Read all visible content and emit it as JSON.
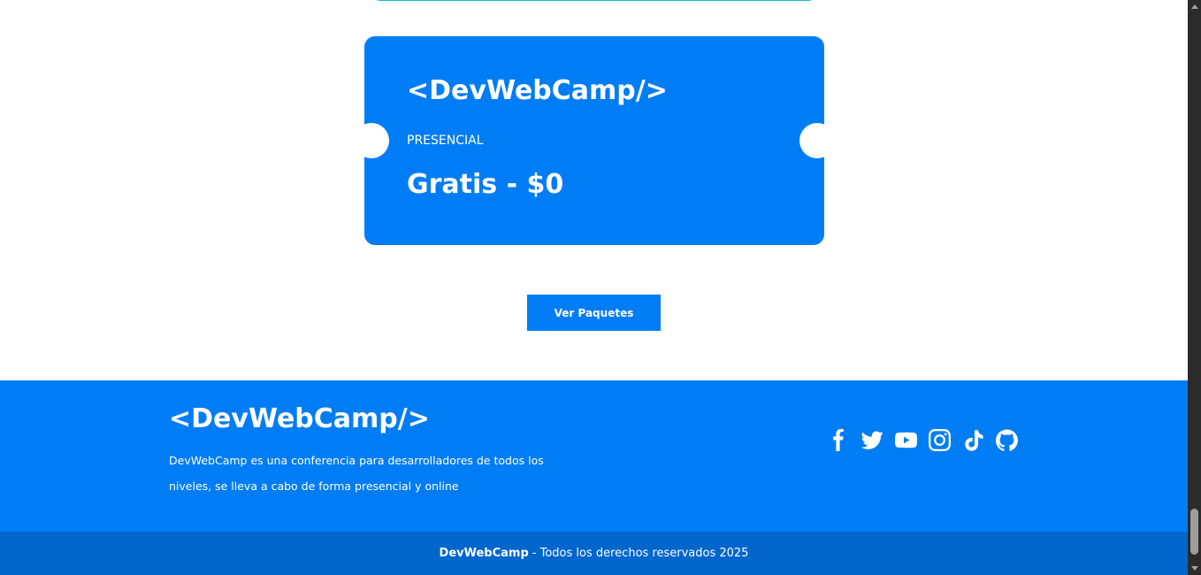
{
  "ticket": {
    "logo": "<DevWebCamp/>",
    "type": "PRESENCIAL",
    "price": "Gratis - $0"
  },
  "cta": {
    "label": "Ver Paquetes"
  },
  "footer": {
    "logo": "<DevWebCamp/>",
    "description": "DevWebCamp es una conferencia para desarrolladores de todos los niveles, se lleva a cabo de forma presencial y online",
    "social": [
      {
        "name": "facebook-icon"
      },
      {
        "name": "twitter-icon"
      },
      {
        "name": "youtube-icon"
      },
      {
        "name": "instagram-icon"
      },
      {
        "name": "tiktok-icon"
      },
      {
        "name": "github-icon"
      }
    ]
  },
  "copyright": {
    "brand": "DevWebCamp",
    "text": "- Todos los derechos reservados 2025"
  },
  "colors": {
    "primary": "#007df4",
    "primary_dark": "#0066cc",
    "accent_teal": "#19b8c7",
    "white": "#ffffff"
  }
}
